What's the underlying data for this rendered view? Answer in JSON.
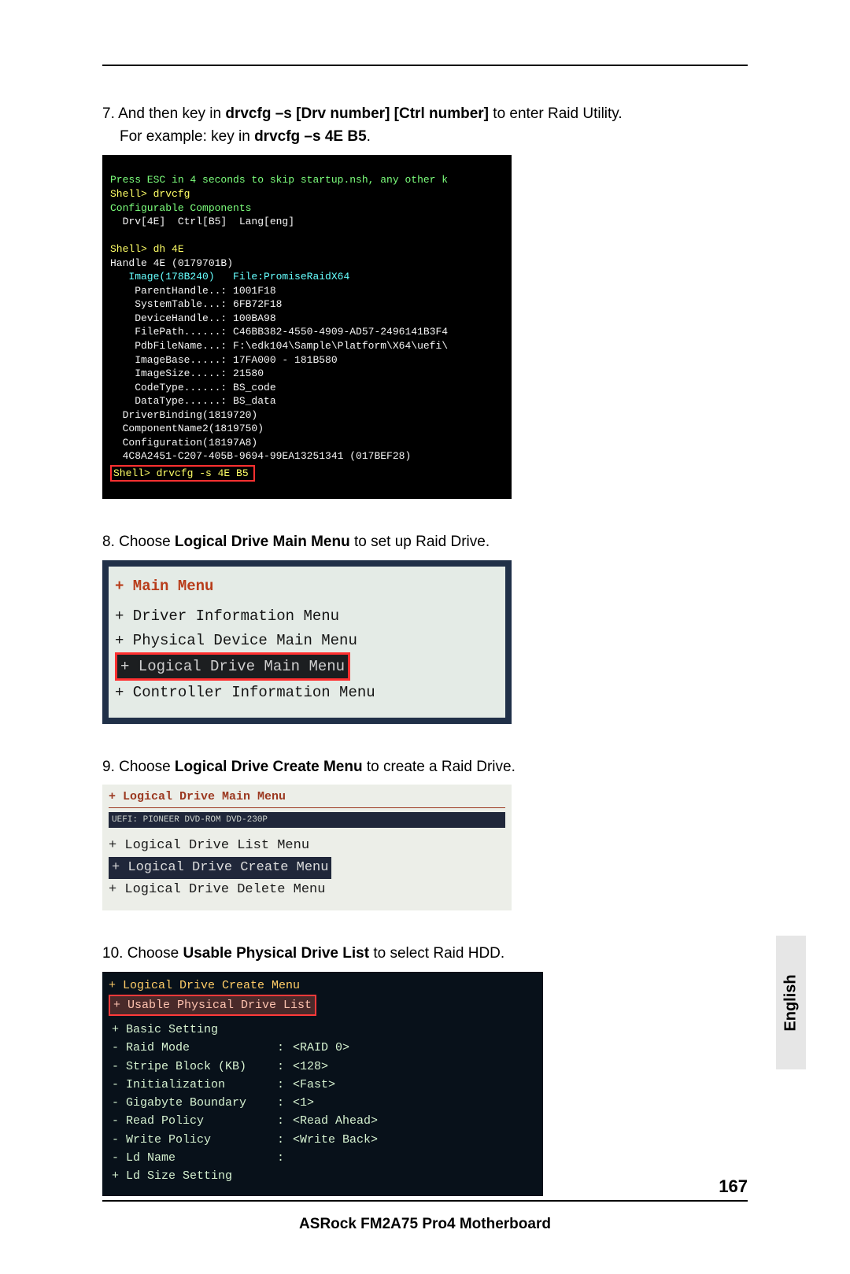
{
  "footer": "ASRock  FM2A75 Pro4  Motherboard",
  "page_number": "167",
  "language_tab": "English",
  "step7": {
    "num": "7.",
    "t1": "And then key in ",
    "b1": "drvcfg –s [Drv number] [Ctrl number]",
    "t2": " to enter Raid Utility.",
    "line2a": "For example: key in ",
    "b2": "drvcfg –s 4E B5",
    "line2b": "."
  },
  "shell": {
    "l01": "Press ESC in 4 seconds to skip startup.nsh, any other k",
    "l02": "Shell> drvcfg",
    "l03": "Configurable Components",
    "l04": "  Drv[4E]  Ctrl[B5]  Lang[eng]",
    "l05": "",
    "l06": "Shell> dh 4E",
    "l07": "Handle 4E (0179701B)",
    "l08": "   Image(178B240)   File:PromiseRaidX64",
    "l09": "    ParentHandle..: 1001F18",
    "l10": "    SystemTable...: 6FB72F18",
    "l11": "    DeviceHandle..: 100BA98",
    "l12": "    FilePath......: C46BB382-4550-4909-AD57-2496141B3F4",
    "l13": "    PdbFileName...: F:\\edk104\\Sample\\Platform\\X64\\uefi\\",
    "l14": "    ImageBase.....: 17FA000 - 181B580",
    "l15": "    ImageSize.....: 21580",
    "l16": "    CodeType......: BS_code",
    "l17": "    DataType......: BS_data",
    "l18": "  DriverBinding(1819720)",
    "l19": "  ComponentName2(1819750)",
    "l20": "  Configuration(18197A8)",
    "l21": "  4C8A2451-C207-405B-9694-99EA13251341 (017BEF28)",
    "l22": "Shell> drvcfg -s 4E B5"
  },
  "step8": {
    "num": "8.",
    "t1": "Choose ",
    "b1": "Logical Drive Main Menu",
    "t2": " to set up Raid Drive."
  },
  "menu2": {
    "title": "+ Main Menu",
    "r1": "+ Driver Information Menu",
    "r2": "+ Physical Device Main Menu",
    "sel": "+ Logical Drive Main Menu",
    "r3": "+ Controller Information Menu"
  },
  "step9": {
    "num": "9.",
    "t1": "Choose ",
    "b1": "Logical Drive Create Menu",
    "t2": " to create a Raid Drive."
  },
  "menu3": {
    "title": "+ Logical Drive Main Menu",
    "sub": "UEFI: PIONEER DVD-ROM DVD-230P",
    "r1": "+ Logical Drive List Menu",
    "sel": "+ Logical Drive Create Menu",
    "r2": "+ Logical Drive Delete Menu"
  },
  "step10": {
    "num": "10.",
    "t1": "Choose ",
    "b1": "Usable Physical Drive List",
    "t2": " to select Raid HDD."
  },
  "menu4": {
    "hdr": "+ Logical Drive Create Menu",
    "sel": "+ Usable Physical Drive List",
    "rows": [
      {
        "a": "+ Basic Setting",
        "b": "",
        "c": ""
      },
      {
        "a": "- Raid Mode",
        "b": ":",
        "c": "<RAID 0>"
      },
      {
        "a": "- Stripe Block (KB)",
        "b": ":",
        "c": "<128>"
      },
      {
        "a": "- Initialization",
        "b": ":",
        "c": "<Fast>"
      },
      {
        "a": "- Gigabyte Boundary",
        "b": ":",
        "c": "<1>"
      },
      {
        "a": "- Read Policy",
        "b": ":",
        "c": "<Read Ahead>"
      },
      {
        "a": "- Write Policy",
        "b": ":",
        "c": "<Write Back>"
      },
      {
        "a": "- Ld Name",
        "b": ":",
        "c": ""
      },
      {
        "a": "",
        "b": "",
        "c": ""
      },
      {
        "a": "+ Ld Size Setting",
        "b": "",
        "c": ""
      }
    ]
  }
}
